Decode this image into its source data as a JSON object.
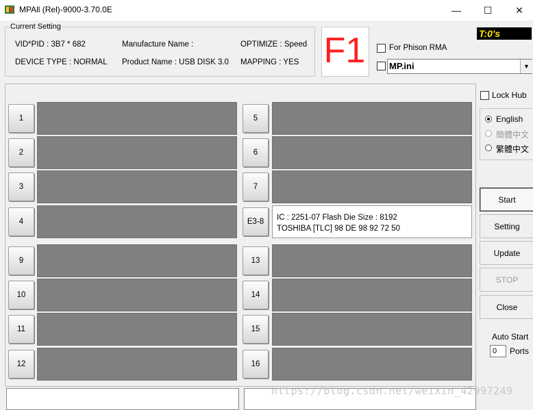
{
  "window": {
    "title": "MPAll (Rel)-9000-3.70.0E",
    "minimize_glyph": "—",
    "maximize_glyph": "☐",
    "close_glyph": "✕"
  },
  "current_setting": {
    "legend": "Current Setting",
    "vid_pid": "VID*PID :  3B7 *  682",
    "device_type": "DEVICE TYPE : NORMAL",
    "manufacture_name": "Manufacture Name :",
    "product_name": "Product Name : USB DISK 3.0",
    "optimize": "OPTIMIZE : Speed",
    "mapping": "MAPPING : YES"
  },
  "f1_label": "F1",
  "timer": "T:0's",
  "for_phison_rma": {
    "label": "For Phison RMA",
    "checked": false
  },
  "ini_file": {
    "value": "MP.ini",
    "checked": false
  },
  "lock_hub": {
    "label": "Lock Hub",
    "checked": false
  },
  "languages": [
    {
      "label": "English",
      "selected": true,
      "enabled": true
    },
    {
      "label": "簡體中文",
      "selected": false,
      "enabled": false
    },
    {
      "label": "繁體中文",
      "selected": false,
      "enabled": true
    }
  ],
  "ports_left": [
    {
      "label": "1",
      "info1": "",
      "info2": ""
    },
    {
      "label": "2",
      "info1": "",
      "info2": ""
    },
    {
      "label": "3",
      "info1": "",
      "info2": ""
    },
    {
      "label": "4",
      "info1": "",
      "info2": ""
    },
    {
      "label": "9",
      "info1": "",
      "info2": ""
    },
    {
      "label": "10",
      "info1": "",
      "info2": ""
    },
    {
      "label": "11",
      "info1": "",
      "info2": ""
    },
    {
      "label": "12",
      "info1": "",
      "info2": ""
    }
  ],
  "ports_right": [
    {
      "label": "5",
      "info1": "",
      "info2": ""
    },
    {
      "label": "6",
      "info1": "",
      "info2": ""
    },
    {
      "label": "7",
      "info1": "",
      "info2": ""
    },
    {
      "label": "E3-8",
      "info1": "IC : 2251-07  Flash Die Size : 8192",
      "info2": "TOSHIBA [TLC] 98 DE 98 92 72 50"
    },
    {
      "label": "13",
      "info1": "",
      "info2": ""
    },
    {
      "label": "14",
      "info1": "",
      "info2": ""
    },
    {
      "label": "15",
      "info1": "",
      "info2": ""
    },
    {
      "label": "16",
      "info1": "",
      "info2": ""
    }
  ],
  "buttons": {
    "start": "Start",
    "setting": "Setting",
    "update": "Update",
    "stop": "STOP",
    "close": "Close"
  },
  "auto_start": {
    "label": "Auto Start",
    "ports_value": "0",
    "ports_label": "Ports"
  },
  "watermark": "https://blog.csdn.net/weixin_42997249"
}
